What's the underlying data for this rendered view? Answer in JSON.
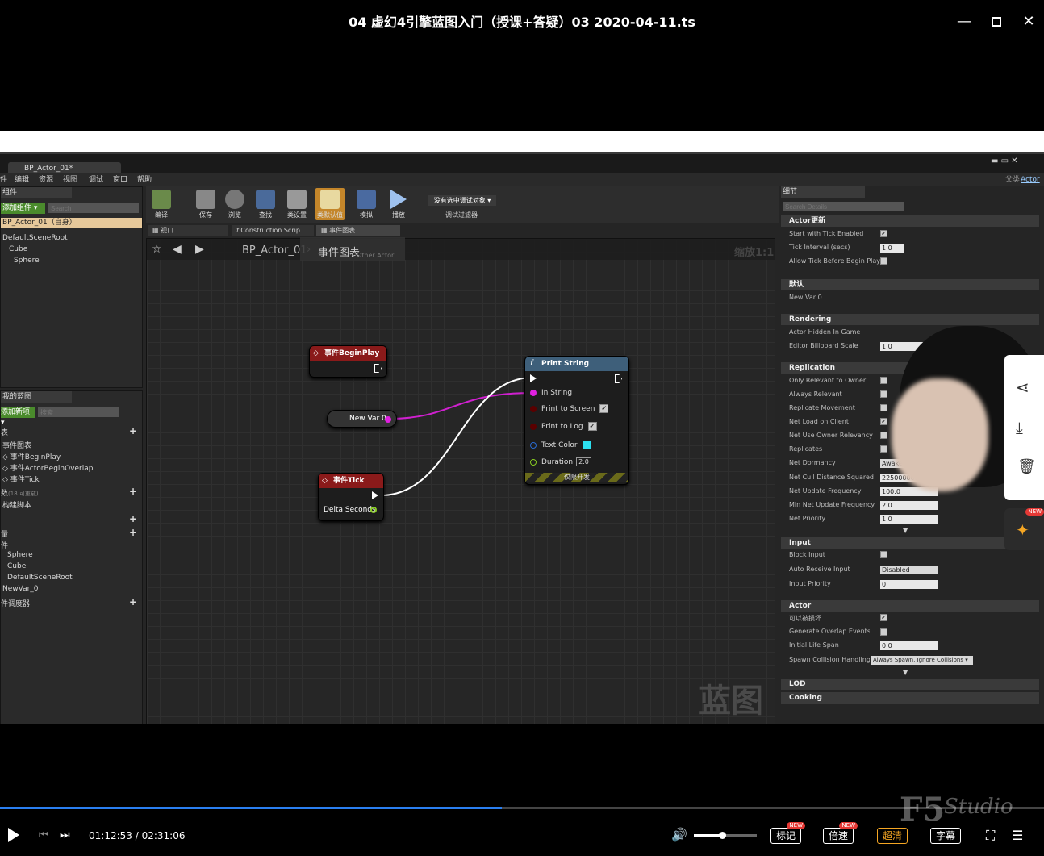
{
  "player": {
    "title": "04 虚幻4引擎蓝图入门（授课+答疑）03 2020-04-11.ts",
    "current_time": "01:12:53",
    "total_time": "02:31:06",
    "separator": " / ",
    "progress": 0.481,
    "volume": 0.45,
    "buttons": {
      "mark": "标记",
      "speed": "倍速",
      "quality": "超清",
      "subtitle": "字幕"
    },
    "new_badge": "NEW",
    "watermark": "Studio"
  },
  "ue": {
    "doc_tab": "BP_Actor_01*",
    "menu": [
      "件",
      "编辑",
      "资源",
      "视图",
      "调试",
      "窗口",
      "帮助"
    ],
    "parent_class_label": "父类",
    "parent_class": "Actor",
    "components": {
      "title": "组件",
      "add_button": "添加组件 ▾",
      "search_placeholder": "Search",
      "root_item": "BP_Actor_01（自身）",
      "items": [
        "DefaultSceneRoot",
        "Cube",
        "Sphere"
      ]
    },
    "mybp": {
      "title": "我的蓝图",
      "add_button": "添加新项 ▾",
      "search_placeholder": "搜索",
      "graphs_head": "表",
      "event_graph": "事件图表",
      "events": [
        "事件BeginPlay",
        "事件ActorBeginOverlap",
        "事件Tick"
      ],
      "functions_head": "数",
      "functions_count": "(18 可重载)",
      "construction": "构建脚本",
      "variables_head": "量",
      "components_head": "件",
      "var_components": [
        "Sphere",
        "Cube",
        "DefaultSceneRoot"
      ],
      "new_var": "NewVar_0",
      "dispatchers": "件调度器"
    },
    "toolbar": [
      {
        "label": "编译"
      },
      {
        "label": "保存"
      },
      {
        "label": "浏览"
      },
      {
        "label": "查找"
      },
      {
        "label": "类设置"
      },
      {
        "label": "类默认值"
      },
      {
        "label": "模拟"
      },
      {
        "label": "播放"
      }
    ],
    "debug_filter": {
      "value": "没有选中调试对象 ▾",
      "label": "调试过滤器"
    },
    "graph_tabs": [
      "视口",
      "Construction Scrip",
      "事件图表"
    ],
    "breadcrumb": {
      "root": "BP_Actor_01",
      "current": "事件图表",
      "zoom": "缩放1:1",
      "tooltip": "Other Actor"
    },
    "graph_watermark": "蓝图",
    "nodes": {
      "begin_play": "事件BeginPlay",
      "new_var": "New Var 0",
      "tick": "事件Tick",
      "delta": "Delta Seconds",
      "print": {
        "title": "Print String",
        "in_string": "In String",
        "to_screen": "Print to Screen",
        "to_log": "Print to Log",
        "text_color": "Text Color",
        "duration": "Duration",
        "duration_val": "2.0",
        "dev_only": "仅限开发"
      }
    },
    "details": {
      "tab": "细节",
      "search_placeholder": "Search Details",
      "sections": {
        "tick": "Actor更新",
        "default": "默认",
        "rendering": "Rendering",
        "replication": "Replication",
        "input": "Input",
        "actor": "Actor",
        "lod": "LOD",
        "cooking": "Cooking"
      },
      "tick": {
        "start": "Start with Tick Enabled",
        "interval": "Tick Interval (secs)",
        "interval_val": "1.0",
        "allow": "Allow Tick Before Begin Play"
      },
      "default": {
        "new_var": "New Var 0"
      },
      "rendering": {
        "hidden": "Actor Hidden In Game",
        "billboard": "Editor Billboard Scale",
        "billboard_val": "1.0"
      },
      "replication": {
        "relevant_owner": "Only Relevant to Owner",
        "always": "Always Relevant",
        "movement": "Replicate Movement",
        "net_load": "Net Load on Client",
        "owner_rel": "Net Use Owner Relevancy",
        "replicates": "Replicates",
        "dormancy": "Net Dormancy",
        "dormancy_val": "Awake",
        "cull": "Net Cull Distance Squared",
        "cull_val": "225000000.0",
        "freq": "Net Update Frequency",
        "freq_val": "100.0",
        "min_freq": "Min Net Update Frequency",
        "min_freq_val": "2.0",
        "priority": "Net Priority",
        "priority_val": "1.0"
      },
      "input": {
        "block": "Block Input",
        "auto": "Auto Receive Input",
        "auto_val": "Disabled",
        "priority": "Input Priority",
        "priority_val": "0"
      },
      "actor": {
        "destructible": "可以被损坏",
        "overlap": "Generate Overlap Events During",
        "lifespan": "Initial Life Span",
        "lifespan_val": "0.0",
        "spawn": "Spawn Collision Handling Method",
        "spawn_val": "Always Spawn, Ignore Collisions ▾"
      }
    }
  }
}
